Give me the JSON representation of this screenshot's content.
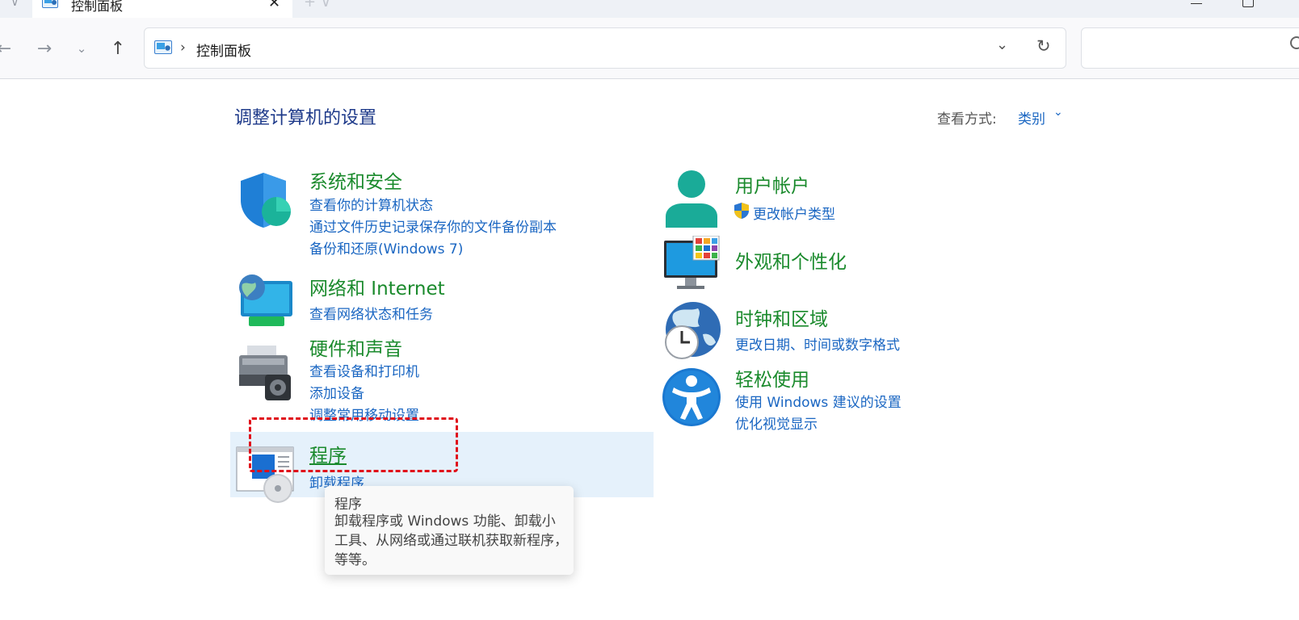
{
  "window": {
    "tab_title": "控制面板",
    "close_glyph": "✕",
    "new_tab_glyph": "+ ∨",
    "recent_glyph": "∨"
  },
  "nav": {
    "back_glyph": "←",
    "forward_glyph": "→",
    "recent_glyph": "⌄",
    "up_glyph": "↑",
    "address_separator": "›",
    "address_text": "控制面板",
    "dropdown_glyph": "⌄",
    "refresh_glyph": "↻",
    "search_placeholder": ""
  },
  "page": {
    "title": "调整计算机的设置",
    "view_by_label": "查看方式:",
    "view_by_value": "类别",
    "view_by_chevron": "⌄"
  },
  "categories": {
    "system": {
      "title": "系统和安全",
      "links": [
        "查看你的计算机状态",
        "通过文件历史记录保存你的文件备份副本",
        "备份和还原(Windows 7)"
      ],
      "icon": "shield-icon"
    },
    "network": {
      "title": "网络和 Internet",
      "links": [
        "查看网络状态和任务"
      ],
      "icon": "globe-network-icon"
    },
    "hardware": {
      "title": "硬件和声音",
      "links": [
        "查看设备和打印机",
        "添加设备",
        "调整常用移动设置"
      ],
      "icon": "printer-icon"
    },
    "programs": {
      "title": "程序",
      "links": [
        "卸载程序"
      ],
      "icon": "programs-icon"
    },
    "users": {
      "title": "用户帐户",
      "links": [
        "更改帐户类型"
      ],
      "icon": "user-icon"
    },
    "appearance": {
      "title": "外观和个性化",
      "links": [],
      "icon": "monitor-icon"
    },
    "clock": {
      "title": "时钟和区域",
      "links": [
        "更改日期、时间或数字格式"
      ],
      "icon": "clock-globe-icon"
    },
    "ease": {
      "title": "轻松使用",
      "links": [
        "使用 Windows 建议的设置",
        "优化视觉显示"
      ],
      "icon": "accessibility-icon"
    }
  },
  "tooltip": {
    "title": "程序",
    "body": "卸载程序或 Windows 功能、卸载小工具、从网络或通过联机获取新程序，等等。"
  },
  "colors": {
    "category_title": "#1a8a2c",
    "link": "#1a66c2",
    "page_title": "#1e3a8a",
    "hover_bg": "#e5f1fb",
    "annotation": "#e0101a"
  }
}
